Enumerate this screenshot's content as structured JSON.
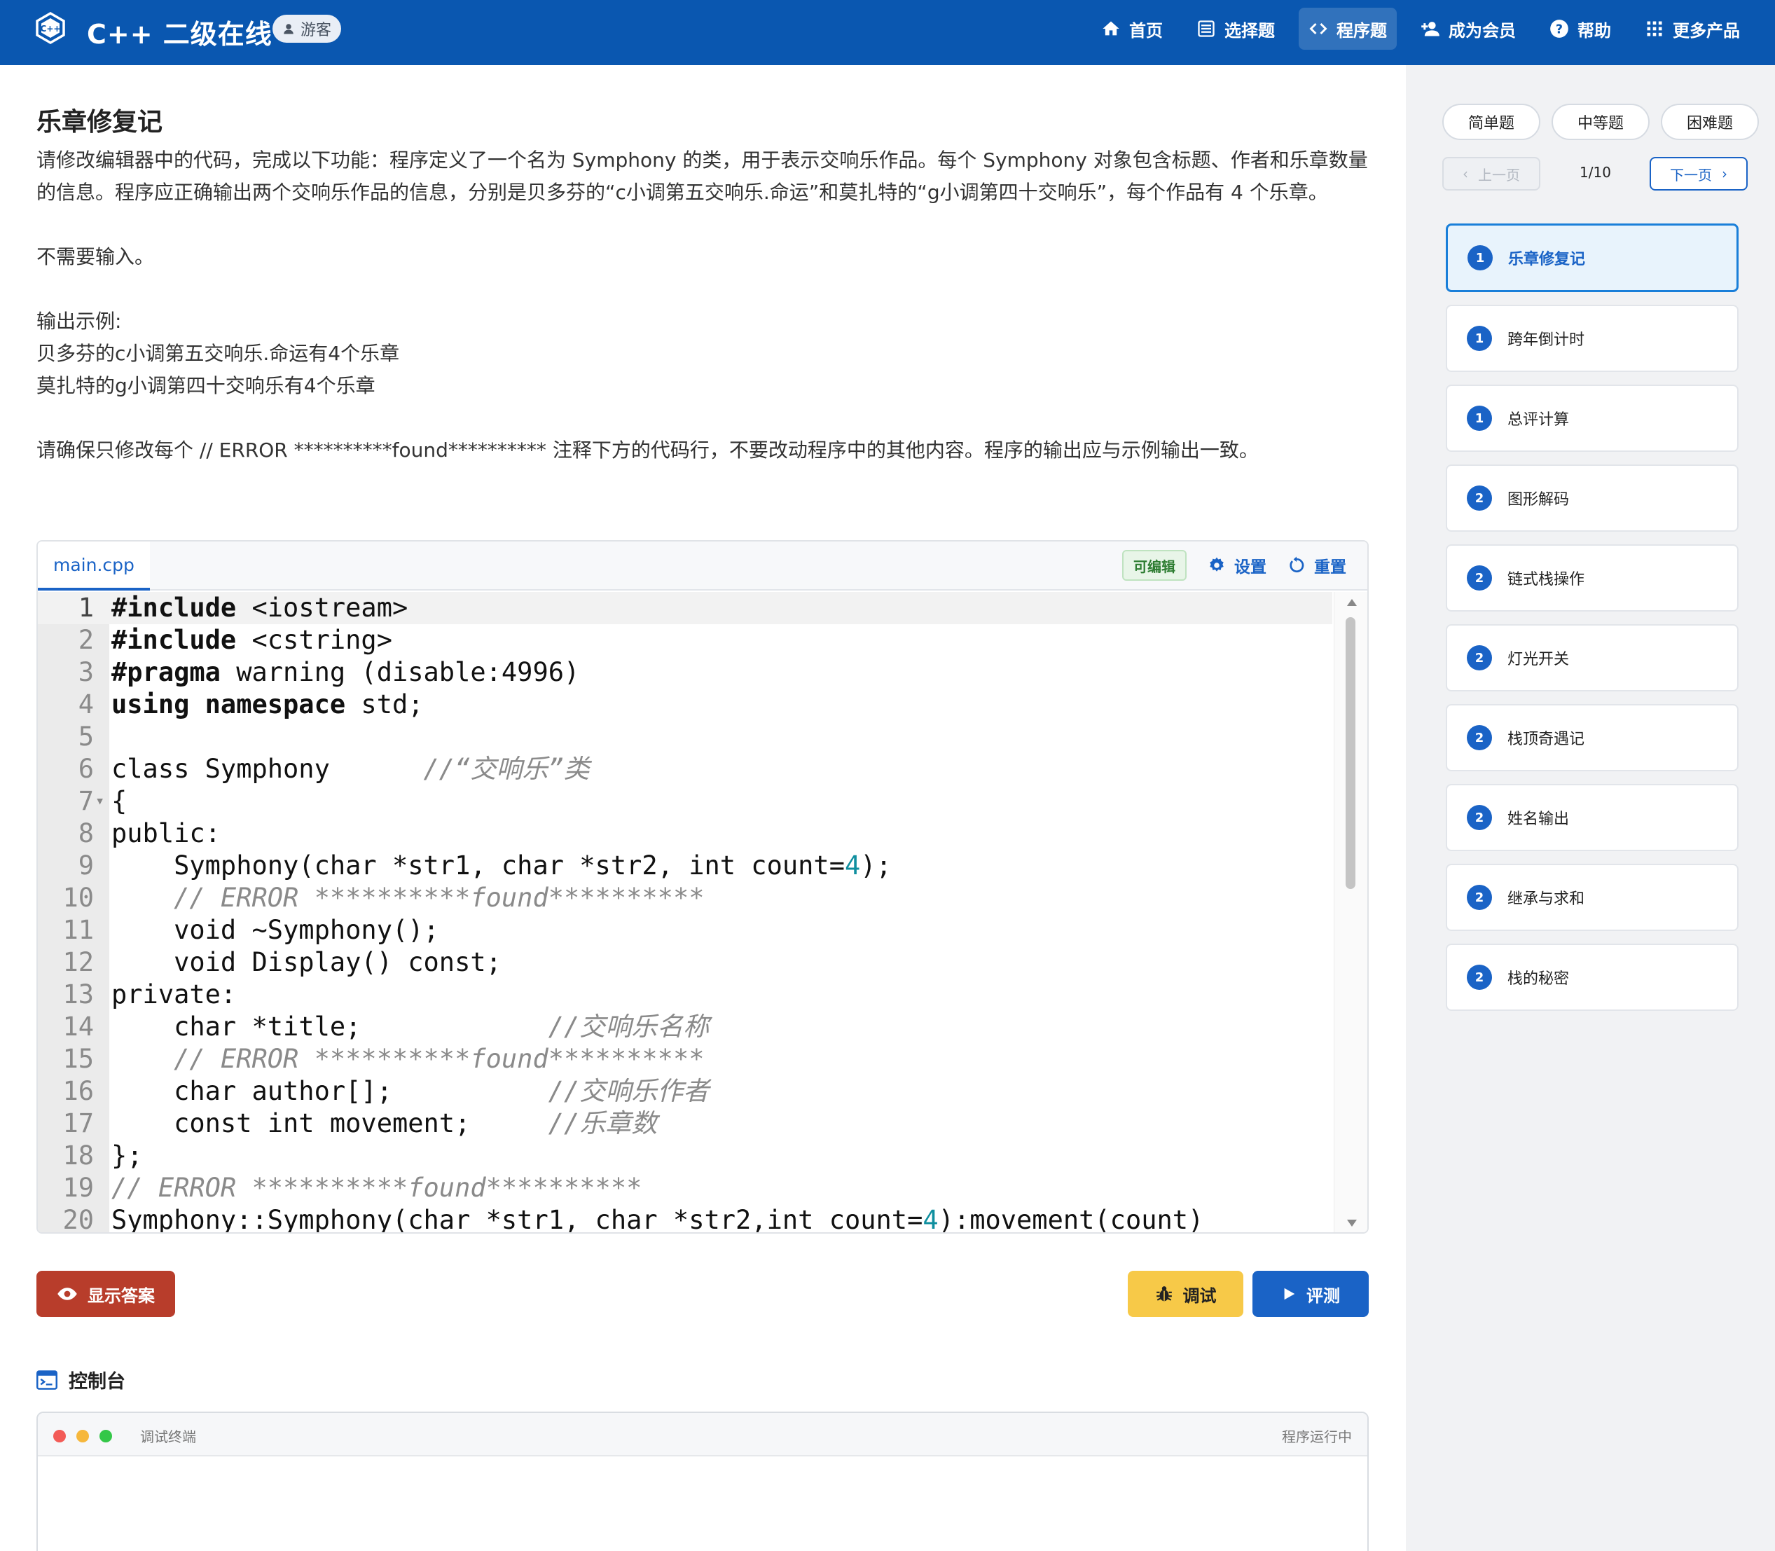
{
  "header": {
    "brand": "C++ 二级在线",
    "guest_label": "游客",
    "nav": [
      {
        "label": "首页",
        "icon": "home-icon"
      },
      {
        "label": "选择题",
        "icon": "list-icon"
      },
      {
        "label": "程序题",
        "icon": "code-icon",
        "active": true
      },
      {
        "label": "成为会员",
        "icon": "add-user-icon"
      },
      {
        "label": "帮助",
        "icon": "help-icon"
      },
      {
        "label": "更多产品",
        "icon": "grid-icon"
      }
    ]
  },
  "problem": {
    "title": "乐章修复记",
    "desc_p1": "请修改编辑器中的代码，完成以下功能：程序定义了一个名为 Symphony 的类，用于表示交响乐作品。每个 Symphony 对象包含标题、作者和乐章数量的信息。程序应正确输出两个交响乐作品的信息，分别是贝多芬的“c小调第五交响乐.命运”和莫扎特的“g小调第四十交响乐”，每个作品有 4 个乐章。",
    "desc_p2": "不需要输入。",
    "desc_p3": "输出示例:",
    "desc_p4": "贝多芬的c小调第五交响乐.命运有4个乐章",
    "desc_p5": "莫扎特的g小调第四十交响乐有4个乐章",
    "desc_p6": "请确保只修改每个 // ERROR **********found********** 注释下方的代码行，不要改动程序中的其他内容。程序的输出应与示例输出一致。"
  },
  "editor": {
    "tab": "main.cpp",
    "editable_label": "可编辑",
    "settings_label": "设置",
    "reset_label": "重置",
    "lines": [
      "#include <iostream>",
      "#include <cstring>",
      "#pragma warning (disable:4996)",
      "using namespace std;",
      "",
      "class Symphony      //“交响乐”类",
      "{",
      "public:",
      "    Symphony(char *str1, char *str2, int count=4);",
      "    // ERROR **********found**********",
      "    void ~Symphony();",
      "    void Display() const;",
      "private:",
      "    char *title;            //交响乐名称",
      "    // ERROR **********found**********",
      "    char author[];          //交响乐作者",
      "    const int movement;     //乐章数",
      "};",
      "// ERROR **********found**********",
      "Symphony::Symphony(char *str1, char *str2,int count=4):movement(count)"
    ]
  },
  "actions": {
    "show_answer": "显示答案",
    "debug": "调试",
    "evaluate": "评测"
  },
  "console": {
    "title": "控制台",
    "terminal_label": "调试终端",
    "status": "程序运行中"
  },
  "sidebar": {
    "difficulty": [
      "简单题",
      "中等题",
      "困难题"
    ],
    "prev_label": "上一页",
    "page": "1/10",
    "next_label": "下一页",
    "questions": [
      {
        "level": "1",
        "name": "乐章修复记",
        "active": true
      },
      {
        "level": "1",
        "name": "跨年倒计时"
      },
      {
        "level": "1",
        "name": "总评计算"
      },
      {
        "level": "2",
        "name": "图形解码"
      },
      {
        "level": "2",
        "name": "链式栈操作"
      },
      {
        "level": "2",
        "name": "灯光开关"
      },
      {
        "level": "2",
        "name": "栈顶奇遇记"
      },
      {
        "level": "2",
        "name": "姓名输出"
      },
      {
        "level": "2",
        "name": "继承与求和"
      },
      {
        "level": "2",
        "name": "栈的秘密"
      }
    ]
  },
  "colors": {
    "brand_blue": "#0a57b0",
    "accent_blue": "#1a63c6",
    "answer_red": "#b83d2b",
    "debug_yellow": "#f7c948"
  }
}
